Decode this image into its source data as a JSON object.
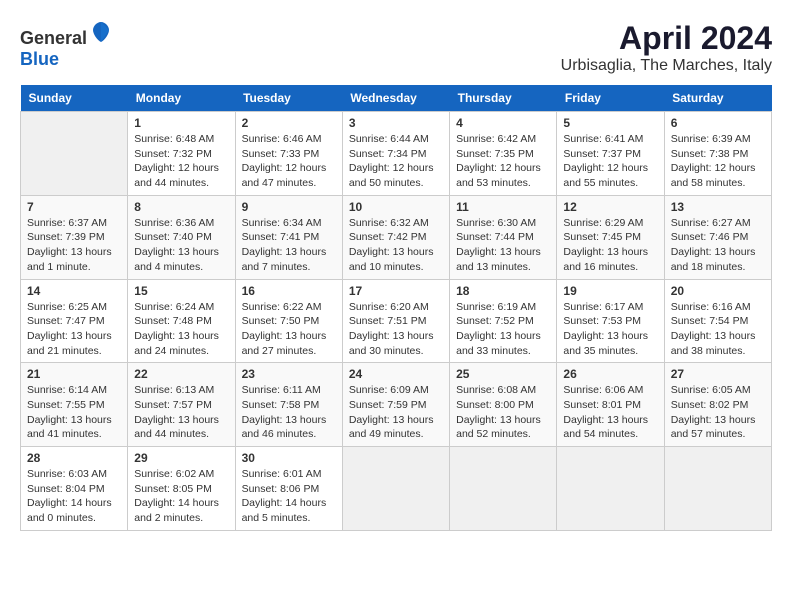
{
  "header": {
    "logo_general": "General",
    "logo_blue": "Blue",
    "title": "April 2024",
    "subtitle": "Urbisaglia, The Marches, Italy"
  },
  "calendar": {
    "days_of_week": [
      "Sunday",
      "Monday",
      "Tuesday",
      "Wednesday",
      "Thursday",
      "Friday",
      "Saturday"
    ],
    "weeks": [
      [
        {
          "day": "",
          "info": ""
        },
        {
          "day": "1",
          "info": "Sunrise: 6:48 AM\nSunset: 7:32 PM\nDaylight: 12 hours\nand 44 minutes."
        },
        {
          "day": "2",
          "info": "Sunrise: 6:46 AM\nSunset: 7:33 PM\nDaylight: 12 hours\nand 47 minutes."
        },
        {
          "day": "3",
          "info": "Sunrise: 6:44 AM\nSunset: 7:34 PM\nDaylight: 12 hours\nand 50 minutes."
        },
        {
          "day": "4",
          "info": "Sunrise: 6:42 AM\nSunset: 7:35 PM\nDaylight: 12 hours\nand 53 minutes."
        },
        {
          "day": "5",
          "info": "Sunrise: 6:41 AM\nSunset: 7:37 PM\nDaylight: 12 hours\nand 55 minutes."
        },
        {
          "day": "6",
          "info": "Sunrise: 6:39 AM\nSunset: 7:38 PM\nDaylight: 12 hours\nand 58 minutes."
        }
      ],
      [
        {
          "day": "7",
          "info": "Sunrise: 6:37 AM\nSunset: 7:39 PM\nDaylight: 13 hours\nand 1 minute."
        },
        {
          "day": "8",
          "info": "Sunrise: 6:36 AM\nSunset: 7:40 PM\nDaylight: 13 hours\nand 4 minutes."
        },
        {
          "day": "9",
          "info": "Sunrise: 6:34 AM\nSunset: 7:41 PM\nDaylight: 13 hours\nand 7 minutes."
        },
        {
          "day": "10",
          "info": "Sunrise: 6:32 AM\nSunset: 7:42 PM\nDaylight: 13 hours\nand 10 minutes."
        },
        {
          "day": "11",
          "info": "Sunrise: 6:30 AM\nSunset: 7:44 PM\nDaylight: 13 hours\nand 13 minutes."
        },
        {
          "day": "12",
          "info": "Sunrise: 6:29 AM\nSunset: 7:45 PM\nDaylight: 13 hours\nand 16 minutes."
        },
        {
          "day": "13",
          "info": "Sunrise: 6:27 AM\nSunset: 7:46 PM\nDaylight: 13 hours\nand 18 minutes."
        }
      ],
      [
        {
          "day": "14",
          "info": "Sunrise: 6:25 AM\nSunset: 7:47 PM\nDaylight: 13 hours\nand 21 minutes."
        },
        {
          "day": "15",
          "info": "Sunrise: 6:24 AM\nSunset: 7:48 PM\nDaylight: 13 hours\nand 24 minutes."
        },
        {
          "day": "16",
          "info": "Sunrise: 6:22 AM\nSunset: 7:50 PM\nDaylight: 13 hours\nand 27 minutes."
        },
        {
          "day": "17",
          "info": "Sunrise: 6:20 AM\nSunset: 7:51 PM\nDaylight: 13 hours\nand 30 minutes."
        },
        {
          "day": "18",
          "info": "Sunrise: 6:19 AM\nSunset: 7:52 PM\nDaylight: 13 hours\nand 33 minutes."
        },
        {
          "day": "19",
          "info": "Sunrise: 6:17 AM\nSunset: 7:53 PM\nDaylight: 13 hours\nand 35 minutes."
        },
        {
          "day": "20",
          "info": "Sunrise: 6:16 AM\nSunset: 7:54 PM\nDaylight: 13 hours\nand 38 minutes."
        }
      ],
      [
        {
          "day": "21",
          "info": "Sunrise: 6:14 AM\nSunset: 7:55 PM\nDaylight: 13 hours\nand 41 minutes."
        },
        {
          "day": "22",
          "info": "Sunrise: 6:13 AM\nSunset: 7:57 PM\nDaylight: 13 hours\nand 44 minutes."
        },
        {
          "day": "23",
          "info": "Sunrise: 6:11 AM\nSunset: 7:58 PM\nDaylight: 13 hours\nand 46 minutes."
        },
        {
          "day": "24",
          "info": "Sunrise: 6:09 AM\nSunset: 7:59 PM\nDaylight: 13 hours\nand 49 minutes."
        },
        {
          "day": "25",
          "info": "Sunrise: 6:08 AM\nSunset: 8:00 PM\nDaylight: 13 hours\nand 52 minutes."
        },
        {
          "day": "26",
          "info": "Sunrise: 6:06 AM\nSunset: 8:01 PM\nDaylight: 13 hours\nand 54 minutes."
        },
        {
          "day": "27",
          "info": "Sunrise: 6:05 AM\nSunset: 8:02 PM\nDaylight: 13 hours\nand 57 minutes."
        }
      ],
      [
        {
          "day": "28",
          "info": "Sunrise: 6:03 AM\nSunset: 8:04 PM\nDaylight: 14 hours\nand 0 minutes."
        },
        {
          "day": "29",
          "info": "Sunrise: 6:02 AM\nSunset: 8:05 PM\nDaylight: 14 hours\nand 2 minutes."
        },
        {
          "day": "30",
          "info": "Sunrise: 6:01 AM\nSunset: 8:06 PM\nDaylight: 14 hours\nand 5 minutes."
        },
        {
          "day": "",
          "info": ""
        },
        {
          "day": "",
          "info": ""
        },
        {
          "day": "",
          "info": ""
        },
        {
          "day": "",
          "info": ""
        }
      ]
    ]
  }
}
